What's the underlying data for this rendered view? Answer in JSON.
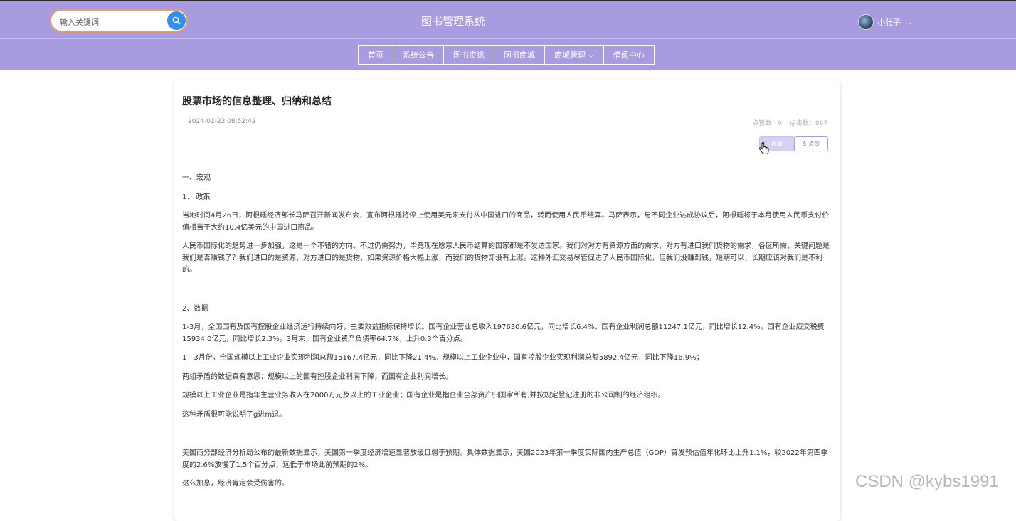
{
  "search": {
    "placeholder": "输入关键词",
    "icon": "search-icon"
  },
  "header": {
    "title": "图书管理系统"
  },
  "user": {
    "name": "小张子",
    "caret": "⌄"
  },
  "nav": {
    "items": [
      {
        "label": "首页"
      },
      {
        "label": "系统公告"
      },
      {
        "label": "图书资讯"
      },
      {
        "label": "图书商城"
      },
      {
        "label": "商城管理 ⌵"
      },
      {
        "label": "借阅中心"
      }
    ]
  },
  "article": {
    "title": "股票市场的信息整理、归纳和总结",
    "date": "2024-01-22 08:52:42",
    "likes": "点赞数：0",
    "views": "点击数：997",
    "collect_label": "收藏",
    "like_label": "♁ 点赞",
    "paragraphs": [
      "一、宏观",
      "1、 政策",
      "当地时间4月26日，阿根廷经济部长马萨召开新闻发布会，宣布阿根廷将停止使用美元来支付从中国进口的商品，转而使用人民币结算。马萨表示，与不同企业达成协议后，阿根廷将于本月使用人民币支付价值相当于大约10.4亿美元的中国进口商品。",
      "人民币国际化的趋势进一步加强，这是一个不错的方向。不过仍需努力，毕竟现在愿意人民币结算的国家都是不发达国家。我们对对方有资源方面的需求，对方有进口我们货物的需求，各区所需，关键问题是我们是否赚钱了？我们进口的是资源，对方进口的是货物，如果资源价格大幅上涨，而我们的货物却没有上涨。这种外汇交易尽管促进了人民币国际化，但我们没赚到钱，短期可以，长期应该对我们是不利的。",
      "2、数据",
      "1-3月，全国国有及国有控股企业经济运行持续向好，主要效益指标保持增长。国有企业营业总收入197630.6亿元，同比增长6.4%。国有企业利润总额11247.1亿元，同比增长12.4%。国有企业应交税费15934.0亿元，同比增长2.3%。3月末，国有企业资产负债率64.7%，上升0.3个百分点。",
      "1—3月份，全国规模以上工业企业实现利润总额15167.4亿元，同比下降21.4%。规模以上工业企业中，国有控股企业实现利润总额5892.4亿元，同比下降16.9%；",
      "两组矛盾的数据真有意思：规模以上的国有控股企业利润下降，而国有企业利润增长。",
      "规模以上工业企业是指年主营业务收入在2000万元及以上的工业企业；国有企业是指企业全部资产归国家所有,并按规定登记注册的非公司制的经济组织。",
      "这种矛盾很可能说明了g进m退。",
      "美国商务部经济分析局公布的最新数据显示，美国第一季度经济增速显著放缓且弱于预期。具体数据显示，美国2023年第一季度实际国内生产总值（GDP）首发预估值年化环比上升1.1%，较2022年第四季度的2.6%放慢了1.5个百分点，远低于市场此前预期的2%。",
      "这么加息，经济肯定会受伤害的。"
    ]
  },
  "watermark": "CSDN @kybs1991"
}
